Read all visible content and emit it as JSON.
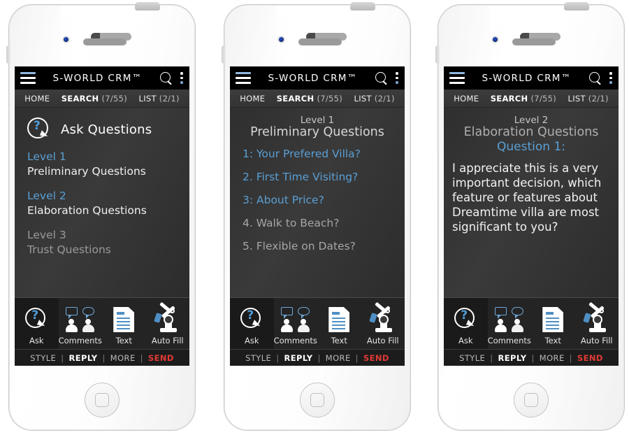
{
  "app": {
    "title": "S-WORLD CRM™",
    "icons": {
      "menu": "hamburger-icon",
      "search": "search-icon",
      "overflow": "kebab-menu-icon"
    }
  },
  "nav": [
    {
      "label": "HOME",
      "count": ""
    },
    {
      "label": "SEARCH",
      "count": "(7/55)",
      "active": true
    },
    {
      "label": "LIST",
      "count": "(2/1)"
    }
  ],
  "toolbar": [
    {
      "label": "Ask",
      "icon": "ask-question-icon"
    },
    {
      "label": "Comments",
      "icon": "comments-icon"
    },
    {
      "label": "Text",
      "icon": "text-document-icon"
    },
    {
      "label": "Auto Fill",
      "icon": "robot-arm-icon"
    }
  ],
  "status": {
    "style": "STYLE",
    "reply": "REPLY",
    "more": "MORE",
    "send": "SEND",
    "separator": "|"
  },
  "phone1": {
    "heading": "Ask Questions",
    "levels": [
      {
        "level": "Level 1",
        "name": "Preliminary Questions",
        "state": "on"
      },
      {
        "level": "Level 2",
        "name": "Elaboration Questions",
        "state": "on"
      },
      {
        "level": "Level 3",
        "name": "Trust Questions",
        "state": "off"
      }
    ]
  },
  "phone2": {
    "level": "Level 1",
    "section": "Preliminary Questions",
    "questions": [
      {
        "text": "1: Your Prefered Villa?",
        "state": "on"
      },
      {
        "text": "2. First Time Visiting?",
        "state": "on"
      },
      {
        "text": "3: About Price?",
        "state": "on"
      },
      {
        "text": "4. Walk to Beach?",
        "state": "off"
      },
      {
        "text": "5. Flexible on Dates?",
        "state": "off"
      }
    ]
  },
  "phone3": {
    "level": "Level 2",
    "section": "Elaboration Questions",
    "question_number": "Question 1:",
    "question_text": "I appreciate this is a very important decision, which feature or features about Dreamtime villa are most significant to you?"
  },
  "colors": {
    "accent_blue": "#5a9fd4",
    "send_red": "#e03a35",
    "screen_dark": "#2b2b2b",
    "app_bar_black": "#000000"
  }
}
